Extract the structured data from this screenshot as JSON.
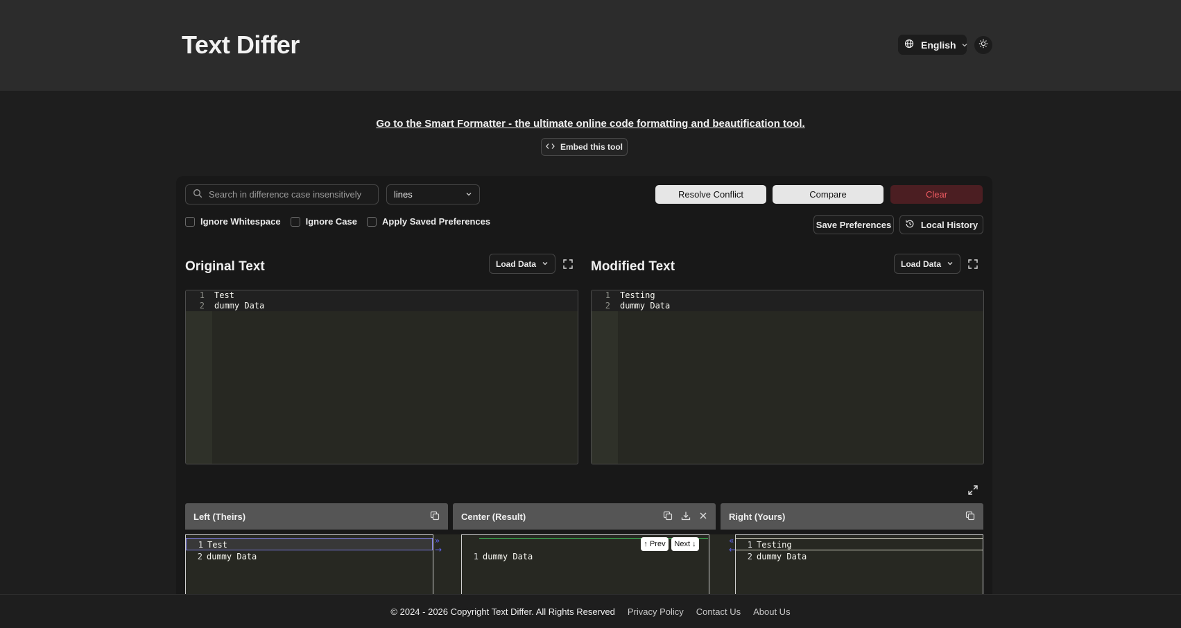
{
  "header": {
    "brand": "Text Differ",
    "language": "English",
    "language_icon": "globe-icon",
    "theme_icon": "sun-icon"
  },
  "promo": {
    "link_text": "Go to the Smart Formatter - the ultimate online code formatting and beautification tool.",
    "embed_label": "Embed this tool",
    "embed_icon": "code-icon"
  },
  "toolbar": {
    "search_placeholder": "Search in difference case insensitively",
    "granularity": "lines",
    "resolve_label": "Resolve Conflict",
    "compare_label": "Compare",
    "clear_label": "Clear",
    "clear_color": "#ef5b62"
  },
  "options": {
    "ignore_whitespace": "Ignore Whitespace",
    "ignore_case": "Ignore Case",
    "apply_saved": "Apply Saved Preferences",
    "save_preferences": "Save Preferences",
    "local_history": "Local History"
  },
  "original": {
    "title": "Original Text",
    "load_label": "Load Data",
    "lines": [
      {
        "num": "1",
        "text": "Test"
      },
      {
        "num": "2",
        "text": "dummy Data"
      }
    ]
  },
  "modified": {
    "title": "Modified Text",
    "load_label": "Load Data",
    "lines": [
      {
        "num": "1",
        "text": "Testing"
      },
      {
        "num": "2",
        "text": "dummy Data"
      }
    ]
  },
  "merge": {
    "left_title": "Left (Theirs)",
    "center_title": "Center (Result)",
    "right_title": "Right (Yours)",
    "left_lines": [
      {
        "num": "1",
        "text": "Test"
      },
      {
        "num": "2",
        "text": "dummy Data"
      }
    ],
    "center_lines": [
      {
        "num": "1",
        "text": "dummy Data"
      }
    ],
    "right_lines": [
      {
        "num": "1",
        "text": "Testing"
      },
      {
        "num": "2",
        "text": "dummy Data"
      }
    ],
    "prev_label": "↑ Prev",
    "next_label": "Next ↓",
    "accept_left_glyph": "»",
    "accept_right_glyph": "«"
  },
  "footer": {
    "copyright": "© 2024 - 2026 Copyright Text Differ. All Rights Reserved",
    "privacy": "Privacy Policy",
    "contact": "Contact Us",
    "about": "About Us"
  }
}
